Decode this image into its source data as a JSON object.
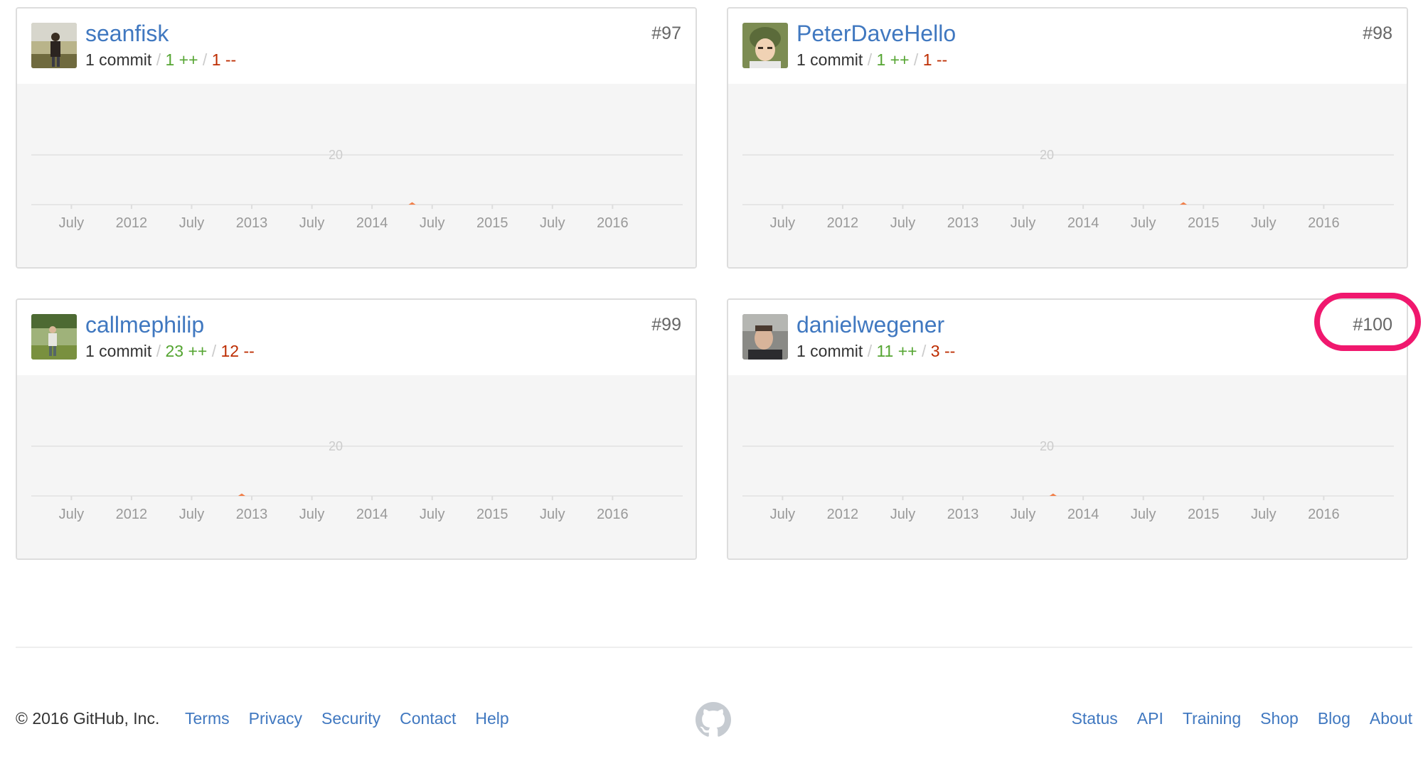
{
  "contributors": [
    {
      "username": "seanfisk",
      "commits": "1 commit",
      "additions": "1 ++",
      "deletions": "1 --",
      "rank": "#97",
      "avatar": "person-outdoors-avatar",
      "chart_data": {
        "type": "area",
        "x_ticks": [
          "July",
          "2012",
          "July",
          "2013",
          "July",
          "2014",
          "July",
          "2015",
          "July",
          "2016"
        ],
        "y_gridlines": [
          20
        ],
        "series": [
          {
            "points": [
              {
                "x": "2014-05",
                "y": 1
              }
            ]
          }
        ]
      }
    },
    {
      "username": "PeterDaveHello",
      "commits": "1 commit",
      "additions": "1 ++",
      "deletions": "1 --",
      "rank": "#98",
      "avatar": "person-helmet-avatar",
      "chart_data": {
        "type": "area",
        "x_ticks": [
          "July",
          "2012",
          "July",
          "2013",
          "July",
          "2014",
          "July",
          "2015",
          "July",
          "2016"
        ],
        "y_gridlines": [
          20
        ],
        "series": [
          {
            "points": [
              {
                "x": "2014-11",
                "y": 1
              }
            ]
          }
        ]
      }
    },
    {
      "username": "callmephilip",
      "commits": "1 commit",
      "additions": "23 ++",
      "deletions": "12 --",
      "rank": "#99",
      "avatar": "person-field-avatar",
      "chart_data": {
        "type": "area",
        "x_ticks": [
          "July",
          "2012",
          "July",
          "2013",
          "July",
          "2014",
          "July",
          "2015",
          "July",
          "2016"
        ],
        "y_gridlines": [
          20
        ],
        "series": [
          {
            "points": [
              {
                "x": "2012-12",
                "y": 1
              }
            ]
          }
        ]
      }
    },
    {
      "username": "danielwegener",
      "commits": "1 commit",
      "additions": "11 ++",
      "deletions": "3 --",
      "rank": "#100",
      "avatar": "person-portrait-avatar",
      "chart_data": {
        "type": "area",
        "x_ticks": [
          "July",
          "2012",
          "July",
          "2013",
          "July",
          "2014",
          "July",
          "2015",
          "July",
          "2016"
        ],
        "y_gridlines": [
          20
        ],
        "series": [
          {
            "points": [
              {
                "x": "2013-10",
                "y": 1
              }
            ]
          }
        ]
      }
    }
  ],
  "highlight_color": "#f0186e",
  "colors": {
    "link": "#4078c0",
    "additions": "#55a532",
    "deletions": "#bd2c00",
    "chart_area": "#f5f5f5",
    "data_point": "#f17f49"
  },
  "footer": {
    "copyright": "© 2016 GitHub, Inc.",
    "left_links": [
      "Terms",
      "Privacy",
      "Security",
      "Contact",
      "Help"
    ],
    "logo": "github-octocat-icon",
    "right_links": [
      "Status",
      "API",
      "Training",
      "Shop",
      "Blog",
      "About"
    ]
  }
}
